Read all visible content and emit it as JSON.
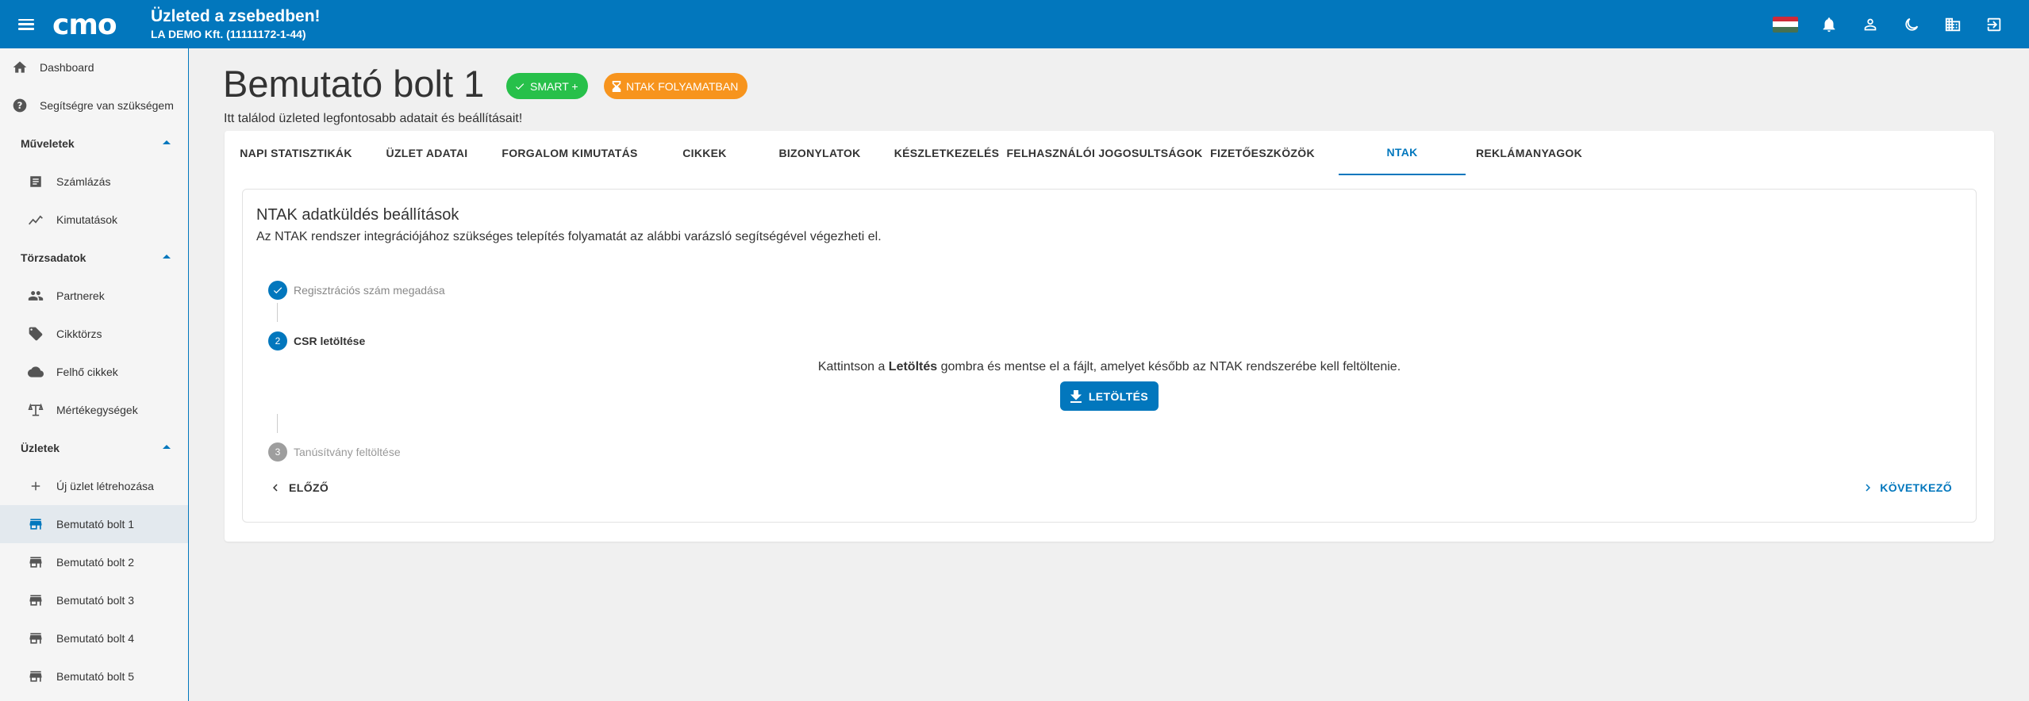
{
  "header": {
    "title": "Üzleted a zsebedben!",
    "company": "LA DEMO Kft. (11111172-1-44)",
    "logo_text": "cmo",
    "icons": [
      "menu-icon",
      "hungarian-flag-icon",
      "bell-icon",
      "person-icon",
      "moon-icon",
      "building-icon",
      "logout-icon"
    ]
  },
  "sidebar": {
    "dashboard": "Dashboard",
    "help": "Segítségre van szükségem",
    "sections": {
      "muveletek": "Műveletek",
      "torzsadatok": "Törzsadatok",
      "uzletek": "Üzletek"
    },
    "items": {
      "szamlazas": "Számlázás",
      "kimutatasok": "Kimutatások",
      "partnerek": "Partnerek",
      "cikktorzs": "Cikktörzs",
      "felho_cikkek": "Felhő cikkek",
      "mertekegysegek": "Mértékegységek",
      "uj_uzlet": "Új üzlet létrehozása",
      "bolt1": "Bemutató bolt 1",
      "bolt2": "Bemutató bolt 2",
      "bolt3": "Bemutató bolt 3",
      "bolt4": "Bemutató bolt 4",
      "bolt5": "Bemutató bolt 5"
    }
  },
  "page": {
    "title": "Bemutató bolt 1",
    "badge_smart": "SMART +",
    "badge_ntak": "NTAK FOLYAMATBAN",
    "subtitle": "Itt találod üzleted legfontosabb adatait és beállításait!"
  },
  "tabs": [
    "NAPI STATISZTIKÁK",
    "ÜZLET ADATAI",
    "FORGALOM KIMUTATÁS",
    "CIKKEK",
    "BIZONYLATOK",
    "KÉSZLETKEZELÉS",
    "FELHASZNÁLÓI JOGOSULTSÁGOK",
    "FIZETŐESZKÖZÖK",
    "NTAK",
    "REKLÁMANYAGOK"
  ],
  "active_tab": "NTAK",
  "ntak": {
    "title": "NTAK adatküldés beállítások",
    "description": "Az NTAK rendszer integrációjához szükséges telepítés folyamatát az alábbi varázsló segítségével végezheti el.",
    "steps": [
      {
        "number": "1",
        "label": "Regisztrációs szám megadása",
        "state": "done"
      },
      {
        "number": "2",
        "label": "CSR letöltése",
        "state": "active"
      },
      {
        "number": "3",
        "label": "Tanúsítvány feltöltése",
        "state": "pending"
      }
    ],
    "instruction_prefix": "Kattintson a ",
    "instruction_bold": "Letöltés",
    "instruction_suffix": " gombra és mentse el a fájlt, amelyet később az NTAK rendszerébe kell feltöltenie.",
    "download_label": "LETÖLTÉS",
    "prev_label": "ELŐZŐ",
    "next_label": "KÖVETKEZŐ"
  },
  "colors": {
    "primary": "#0277bd",
    "green": "#27c04a",
    "orange": "#f7941d",
    "step_pending": "#9e9e9e"
  }
}
